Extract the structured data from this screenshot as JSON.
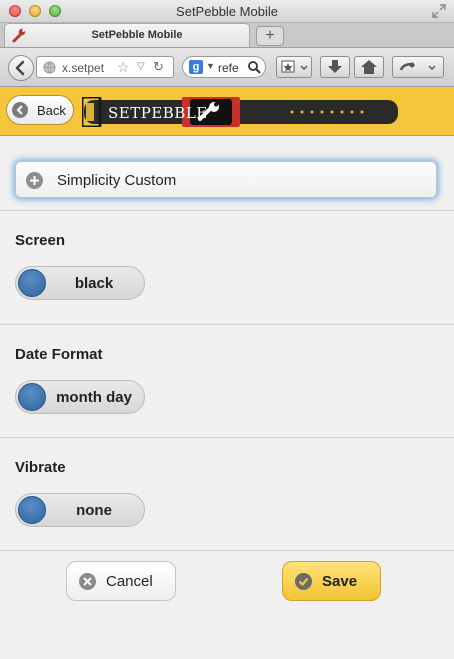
{
  "window": {
    "title": "SetPebble Mobile",
    "tab_label": "SetPebble Mobile",
    "new_tab": "+"
  },
  "navbar": {
    "url_text": "x.setpet",
    "search_text": "refe",
    "search_engine_icon": "google-icon"
  },
  "header": {
    "back_label": "Back",
    "logo_text": "SETPEBBLE",
    "colors": {
      "header_bg": "#f5c53a",
      "accent": "#2f639d"
    }
  },
  "app": {
    "collapsible_label": "Simplicity Custom",
    "fields": [
      {
        "label": "Screen",
        "value": "black"
      },
      {
        "label": "Date Format",
        "value": "month day"
      },
      {
        "label": "Vibrate",
        "value": "none"
      }
    ],
    "cancel_label": "Cancel",
    "save_label": "Save"
  }
}
